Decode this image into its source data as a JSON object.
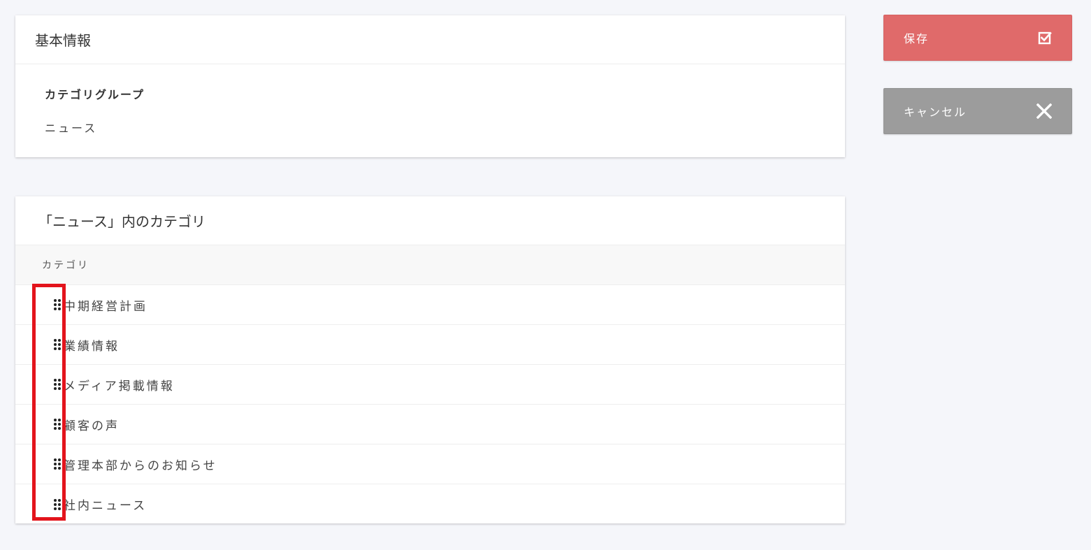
{
  "basic_info": {
    "title": "基本情報",
    "field_label": "カテゴリグループ",
    "field_value": "ニュース"
  },
  "categories_card": {
    "title": "「ニュース」内のカテゴリ",
    "column_header": "カテゴリ",
    "rows": [
      {
        "label": "中期経営計画"
      },
      {
        "label": "業績情報"
      },
      {
        "label": "メディア掲載情報"
      },
      {
        "label": "顧客の声"
      },
      {
        "label": "管理本部からのお知らせ"
      },
      {
        "label": "社内ニュース"
      }
    ]
  },
  "actions": {
    "save_label": "保存",
    "save_icon": "checkbox-checked-icon",
    "save_color": "#e06a6a",
    "cancel_label": "キャンセル",
    "cancel_icon": "close-icon",
    "cancel_color": "#9c9c9c"
  },
  "highlight_color": "#e3141c"
}
